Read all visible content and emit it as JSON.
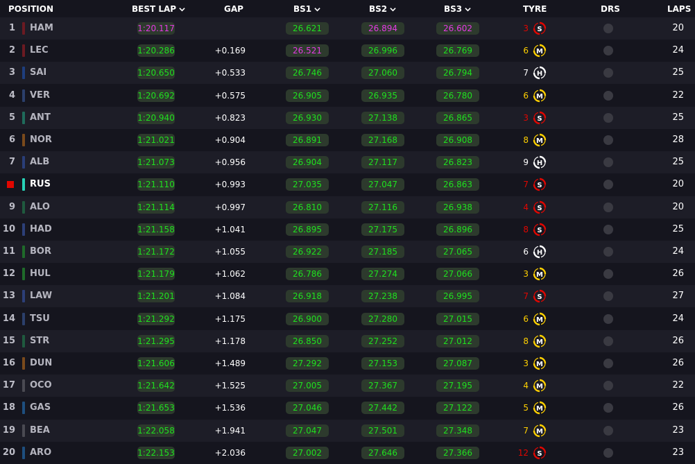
{
  "header": {
    "position": "POSITION",
    "best_lap": "BEST LAP",
    "gap": "GAP",
    "bs1": "BS1",
    "bs2": "BS2",
    "bs3": "BS3",
    "tyre": "TYRE",
    "drs": "DRS",
    "laps": "LAPS"
  },
  "colors": {
    "green_time": "#1fe01f",
    "purple_time": "#e33ae3",
    "soft": "#e10600",
    "medium": "#ffd000",
    "hard": "#ffffff",
    "highlight_marker": "#e10600"
  },
  "rows": [
    {
      "pos": "1",
      "driver": "HAM",
      "team_color": "#6b1a22",
      "best_lap": "1:20.117",
      "best_lap_style": "purple",
      "gap": "",
      "bs1": "26.621",
      "bs1_style": "green",
      "bs2": "26.894",
      "bs2_style": "purple",
      "bs3": "26.602",
      "bs3_style": "purple",
      "tyre_age": "3",
      "tyre": "S",
      "laps": "20",
      "highlight": false
    },
    {
      "pos": "2",
      "driver": "LEC",
      "team_color": "#6b1a22",
      "best_lap": "1:20.286",
      "best_lap_style": "green",
      "gap": "+0.169",
      "bs1": "26.521",
      "bs1_style": "purple",
      "bs2": "26.996",
      "bs2_style": "green",
      "bs3": "26.769",
      "bs3_style": "green",
      "tyre_age": "6",
      "tyre": "M",
      "laps": "24",
      "highlight": false
    },
    {
      "pos": "3",
      "driver": "SAI",
      "team_color": "#1e3e7e",
      "best_lap": "1:20.650",
      "best_lap_style": "green",
      "gap": "+0.533",
      "bs1": "26.746",
      "bs1_style": "green",
      "bs2": "27.060",
      "bs2_style": "green",
      "bs3": "26.794",
      "bs3_style": "green",
      "tyre_age": "7",
      "tyre": "H",
      "laps": "25",
      "highlight": false
    },
    {
      "pos": "4",
      "driver": "VER",
      "team_color": "#2b3f6b",
      "best_lap": "1:20.692",
      "best_lap_style": "green",
      "gap": "+0.575",
      "bs1": "26.905",
      "bs1_style": "green",
      "bs2": "26.935",
      "bs2_style": "green",
      "bs3": "26.780",
      "bs3_style": "green",
      "tyre_age": "6",
      "tyre": "M",
      "laps": "22",
      "highlight": false
    },
    {
      "pos": "5",
      "driver": "ANT",
      "team_color": "#1f6b5b",
      "best_lap": "1:20.940",
      "best_lap_style": "green",
      "gap": "+0.823",
      "bs1": "26.930",
      "bs1_style": "green",
      "bs2": "27.138",
      "bs2_style": "green",
      "bs3": "26.865",
      "bs3_style": "green",
      "tyre_age": "3",
      "tyre": "S",
      "laps": "25",
      "highlight": false
    },
    {
      "pos": "6",
      "driver": "NOR",
      "team_color": "#7a4a1c",
      "best_lap": "1:21.021",
      "best_lap_style": "green",
      "gap": "+0.904",
      "bs1": "26.891",
      "bs1_style": "green",
      "bs2": "27.168",
      "bs2_style": "green",
      "bs3": "26.908",
      "bs3_style": "green",
      "tyre_age": "8",
      "tyre": "M",
      "laps": "28",
      "highlight": false
    },
    {
      "pos": "7",
      "driver": "ALB",
      "team_color": "#2a3e78",
      "best_lap": "1:21.073",
      "best_lap_style": "green",
      "gap": "+0.956",
      "bs1": "26.904",
      "bs1_style": "green",
      "bs2": "27.117",
      "bs2_style": "green",
      "bs3": "26.823",
      "bs3_style": "green",
      "tyre_age": "9",
      "tyre": "H",
      "laps": "25",
      "highlight": false
    },
    {
      "pos": "",
      "driver": "RUS",
      "team_color": "#27d1b6",
      "best_lap": "1:21.110",
      "best_lap_style": "green",
      "gap": "+0.993",
      "bs1": "27.035",
      "bs1_style": "green",
      "bs2": "27.047",
      "bs2_style": "green",
      "bs3": "26.863",
      "bs3_style": "green",
      "tyre_age": "7",
      "tyre": "S",
      "laps": "20",
      "highlight": true
    },
    {
      "pos": "9",
      "driver": "ALO",
      "team_color": "#1f5a3e",
      "best_lap": "1:21.114",
      "best_lap_style": "green",
      "gap": "+0.997",
      "bs1": "26.810",
      "bs1_style": "green",
      "bs2": "27.116",
      "bs2_style": "green",
      "bs3": "26.938",
      "bs3_style": "green",
      "tyre_age": "4",
      "tyre": "S",
      "laps": "20",
      "highlight": false
    },
    {
      "pos": "10",
      "driver": "HAD",
      "team_color": "#2c3f78",
      "best_lap": "1:21.158",
      "best_lap_style": "green",
      "gap": "+1.041",
      "bs1": "26.895",
      "bs1_style": "green",
      "bs2": "27.175",
      "bs2_style": "green",
      "bs3": "26.896",
      "bs3_style": "green",
      "tyre_age": "8",
      "tyre": "S",
      "laps": "25",
      "highlight": false
    },
    {
      "pos": "11",
      "driver": "BOR",
      "team_color": "#1f6a2a",
      "best_lap": "1:21.172",
      "best_lap_style": "green",
      "gap": "+1.055",
      "bs1": "26.922",
      "bs1_style": "green",
      "bs2": "27.185",
      "bs2_style": "green",
      "bs3": "27.065",
      "bs3_style": "green",
      "tyre_age": "6",
      "tyre": "H",
      "laps": "24",
      "highlight": false
    },
    {
      "pos": "12",
      "driver": "HUL",
      "team_color": "#1f6a2a",
      "best_lap": "1:21.179",
      "best_lap_style": "green",
      "gap": "+1.062",
      "bs1": "26.786",
      "bs1_style": "green",
      "bs2": "27.274",
      "bs2_style": "green",
      "bs3": "27.066",
      "bs3_style": "green",
      "tyre_age": "3",
      "tyre": "M",
      "laps": "26",
      "highlight": false
    },
    {
      "pos": "13",
      "driver": "LAW",
      "team_color": "#2c3f78",
      "best_lap": "1:21.201",
      "best_lap_style": "green",
      "gap": "+1.084",
      "bs1": "26.918",
      "bs1_style": "green",
      "bs2": "27.238",
      "bs2_style": "green",
      "bs3": "26.995",
      "bs3_style": "green",
      "tyre_age": "7",
      "tyre": "S",
      "laps": "27",
      "highlight": false
    },
    {
      "pos": "14",
      "driver": "TSU",
      "team_color": "#2b3f6b",
      "best_lap": "1:21.292",
      "best_lap_style": "green",
      "gap": "+1.175",
      "bs1": "26.900",
      "bs1_style": "green",
      "bs2": "27.280",
      "bs2_style": "green",
      "bs3": "27.015",
      "bs3_style": "green",
      "tyre_age": "6",
      "tyre": "M",
      "laps": "24",
      "highlight": false
    },
    {
      "pos": "15",
      "driver": "STR",
      "team_color": "#1f5a3e",
      "best_lap": "1:21.295",
      "best_lap_style": "green",
      "gap": "+1.178",
      "bs1": "26.850",
      "bs1_style": "green",
      "bs2": "27.252",
      "bs2_style": "green",
      "bs3": "27.012",
      "bs3_style": "green",
      "tyre_age": "8",
      "tyre": "M",
      "laps": "26",
      "highlight": false
    },
    {
      "pos": "16",
      "driver": "DUN",
      "team_color": "#7a4a1c",
      "best_lap": "1:21.606",
      "best_lap_style": "green",
      "gap": "+1.489",
      "bs1": "27.292",
      "bs1_style": "green",
      "bs2": "27.153",
      "bs2_style": "green",
      "bs3": "27.087",
      "bs3_style": "green",
      "tyre_age": "3",
      "tyre": "M",
      "laps": "26",
      "highlight": false
    },
    {
      "pos": "17",
      "driver": "OCO",
      "team_color": "#4a4a52",
      "best_lap": "1:21.642",
      "best_lap_style": "green",
      "gap": "+1.525",
      "bs1": "27.005",
      "bs1_style": "green",
      "bs2": "27.367",
      "bs2_style": "green",
      "bs3": "27.195",
      "bs3_style": "green",
      "tyre_age": "4",
      "tyre": "M",
      "laps": "22",
      "highlight": false
    },
    {
      "pos": "18",
      "driver": "GAS",
      "team_color": "#1e4e7e",
      "best_lap": "1:21.653",
      "best_lap_style": "green",
      "gap": "+1.536",
      "bs1": "27.046",
      "bs1_style": "green",
      "bs2": "27.442",
      "bs2_style": "green",
      "bs3": "27.122",
      "bs3_style": "green",
      "tyre_age": "5",
      "tyre": "M",
      "laps": "26",
      "highlight": false
    },
    {
      "pos": "19",
      "driver": "BEA",
      "team_color": "#4a4a52",
      "best_lap": "1:22.058",
      "best_lap_style": "green",
      "gap": "+1.941",
      "bs1": "27.047",
      "bs1_style": "green",
      "bs2": "27.501",
      "bs2_style": "green",
      "bs3": "27.348",
      "bs3_style": "green",
      "tyre_age": "7",
      "tyre": "M",
      "laps": "23",
      "highlight": false
    },
    {
      "pos": "20",
      "driver": "ARO",
      "team_color": "#1e4e7e",
      "best_lap": "1:22.153",
      "best_lap_style": "green",
      "gap": "+2.036",
      "bs1": "27.002",
      "bs1_style": "green",
      "bs2": "27.646",
      "bs2_style": "green",
      "bs3": "27.366",
      "bs3_style": "green",
      "tyre_age": "12",
      "tyre": "S",
      "laps": "23",
      "highlight": false
    }
  ]
}
